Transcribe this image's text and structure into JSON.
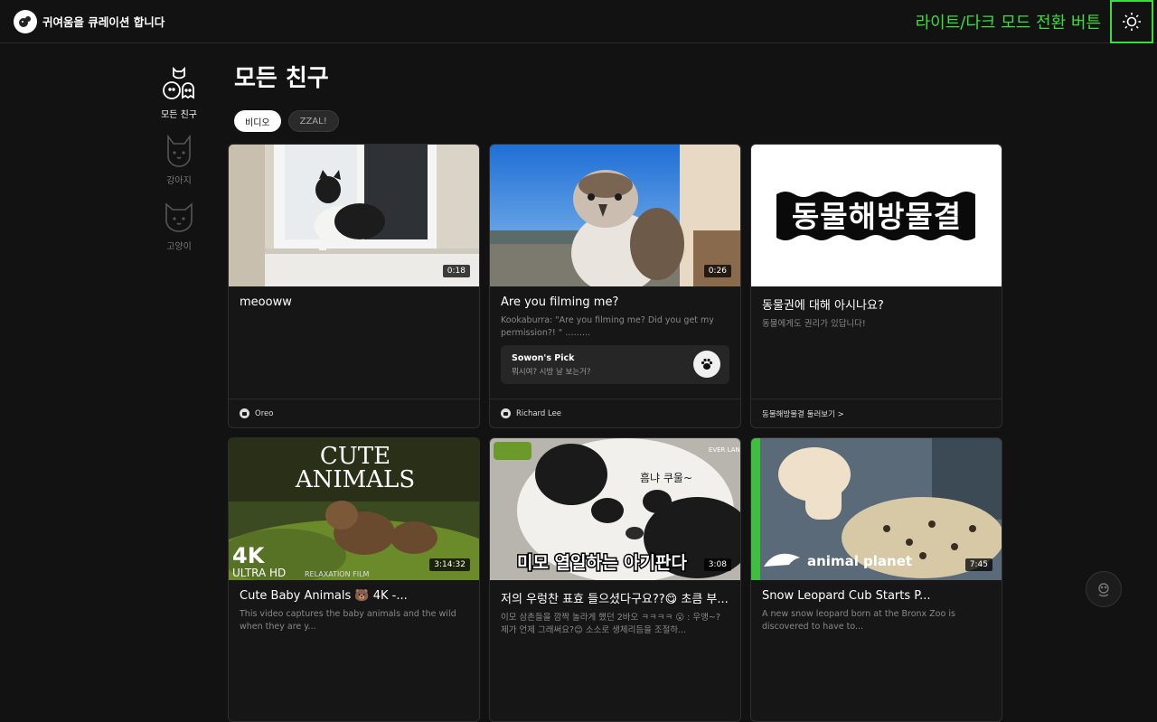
{
  "header": {
    "brand": "귀여움을 큐레이션 합니다",
    "theme_annotation": "라이트/다크 모드 전환 버튼"
  },
  "sidebar": {
    "items": [
      {
        "label": "모든 친구",
        "active": true
      },
      {
        "label": "강아지",
        "active": false
      },
      {
        "label": "고양이",
        "active": false
      }
    ]
  },
  "page_title": "모든 친구",
  "chips": [
    "비디오",
    "ZZAL!"
  ],
  "cards": [
    {
      "title": "meooww",
      "desc": "",
      "duration": "0:18",
      "footer": "Oreo"
    },
    {
      "title": "Are you filming me?",
      "desc": "Kookaburra: \"Are you filming me? Did you get my permission?! \" ……...",
      "duration": "0:26",
      "footer": "Richard Lee",
      "pick_title": "Sowon's Pick",
      "pick_sub": "뭐시여? 시방 날 보는거?"
    },
    {
      "title": "동물권에 대해 아시나요?",
      "desc": "동물에게도 권리가 있답니다!",
      "footer": "동물해방물결 둘러보기 >",
      "banner": "동물해방물결"
    },
    {
      "title": "Cute Baby Animals 🐻 4K -...",
      "desc": "This video captures the baby animals and the wild when they are y...",
      "duration": "3:14:32",
      "overlay_top1": "CUTE",
      "overlay_top2": "ANIMALS",
      "overlay_4k": "4K",
      "overlay_uhd": "ULTRA HD",
      "overlay_relax": "RELAXATION FILM"
    },
    {
      "title": "저의 우렁찬 표효 들으셨다구요??😋 초큼 부...",
      "desc": "이모 삼촌들을 깜짝 놀라게 했던 2바오 ㅋㅋㅋㅋ 😮 : 우앵~? 제가 언제 그래써요?😊 소소로 생체리듬을 조절하...",
      "duration": "3:08",
      "overlay_caption": "미모 열일하는 아기판다",
      "overlay_hand": "흠냐 쿠울~",
      "overlay_brand": "EVER LAND"
    },
    {
      "title": "Snow Leopard Cub Starts P...",
      "desc": "A new snow leopard born at the Bronx Zoo is discovered to have to...",
      "duration": "7:45",
      "overlay_brand": "animal planet"
    }
  ],
  "colors": {
    "accent": "#3ddc3d",
    "background": "#121212"
  }
}
